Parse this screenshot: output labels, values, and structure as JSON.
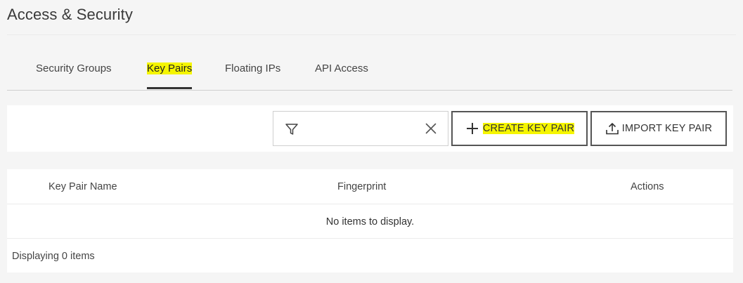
{
  "page": {
    "title": "Access & Security"
  },
  "tabs": [
    {
      "label": "Security Groups",
      "active": false
    },
    {
      "label": "Key Pairs",
      "active": true
    },
    {
      "label": "Floating IPs",
      "active": false
    },
    {
      "label": "API Access",
      "active": false
    }
  ],
  "toolbar": {
    "filter": {
      "value": "",
      "placeholder": "",
      "icon": "filter-icon",
      "clear_icon": "close-icon"
    },
    "create_button": {
      "label": "CREATE KEY PAIR",
      "icon": "plus-icon"
    },
    "import_button": {
      "label": "IMPORT KEY PAIR",
      "icon": "upload-icon"
    }
  },
  "table": {
    "columns": [
      "Key Pair Name",
      "Fingerprint",
      "Actions"
    ],
    "rows": [],
    "empty_message": "No items to display.",
    "footer": "Displaying 0 items"
  },
  "colors": {
    "highlight": "#f5f500",
    "active_tab_underline": "#333333",
    "button_border": "#555555",
    "background": "#f5f5f5"
  }
}
